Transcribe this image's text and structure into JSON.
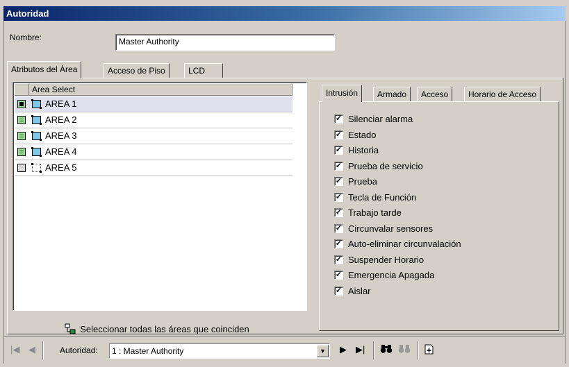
{
  "window": {
    "title": "Autoridad"
  },
  "nombre": {
    "label": "Nombre:",
    "value": "Master Authority"
  },
  "main_tabs": [
    {
      "label": "Atributos del Área",
      "active": true
    },
    {
      "label": "Acceso de Piso",
      "active": false
    },
    {
      "label": "LCD",
      "active": false
    }
  ],
  "area_grid": {
    "column_header": "Area Select",
    "rows": [
      {
        "label": "AREA 1",
        "state": "selected-green",
        "selected": true
      },
      {
        "label": "AREA 2",
        "state": "green"
      },
      {
        "label": "AREA 3",
        "state": "green"
      },
      {
        "label": "AREA 4",
        "state": "green"
      },
      {
        "label": "AREA 5",
        "state": "empty"
      }
    ]
  },
  "select_all_button": {
    "label": "Seleccionar todas las áreas que coinciden"
  },
  "sub_tabs": [
    {
      "label": "Intrusión",
      "active": true
    },
    {
      "label": "Armado",
      "active": false
    },
    {
      "label": "Acceso",
      "active": false
    },
    {
      "label": "Horario de Acceso",
      "active": false
    }
  ],
  "permissions": [
    {
      "label": "Silenciar alarma",
      "checked": true
    },
    {
      "label": "Estado",
      "checked": true
    },
    {
      "label": "Historia",
      "checked": true
    },
    {
      "label": "Prueba de servicio",
      "checked": true
    },
    {
      "label": "Prueba",
      "checked": true
    },
    {
      "label": "Tecla de Función",
      "checked": true
    },
    {
      "label": "Trabajo tarde",
      "checked": true
    },
    {
      "label": "Circunvalar sensores",
      "checked": true
    },
    {
      "label": "Auto-eliminar circunvalación",
      "checked": true
    },
    {
      "label": "Suspender Horario",
      "checked": true
    },
    {
      "label": "Emergencia Apagada",
      "checked": true
    },
    {
      "label": "Aislar",
      "checked": true
    }
  ],
  "navigator": {
    "label": "Autoridad:",
    "value": "1 : Master Authority",
    "first_icon": "first-record-icon",
    "prev_icon": "previous-record-icon",
    "next_icon": "next-record-icon",
    "last_icon": "last-record-icon",
    "find_icon": "binoculars-icon",
    "find_next_icon": "binoculars-disabled-icon",
    "new_icon": "new-record-icon"
  },
  "colors": {
    "title_start": "#0a246a",
    "title_end": "#a6caf0",
    "face": "#d4d0c8",
    "area_active": "#9fe09f",
    "row_selected": "#e0e0ef"
  }
}
